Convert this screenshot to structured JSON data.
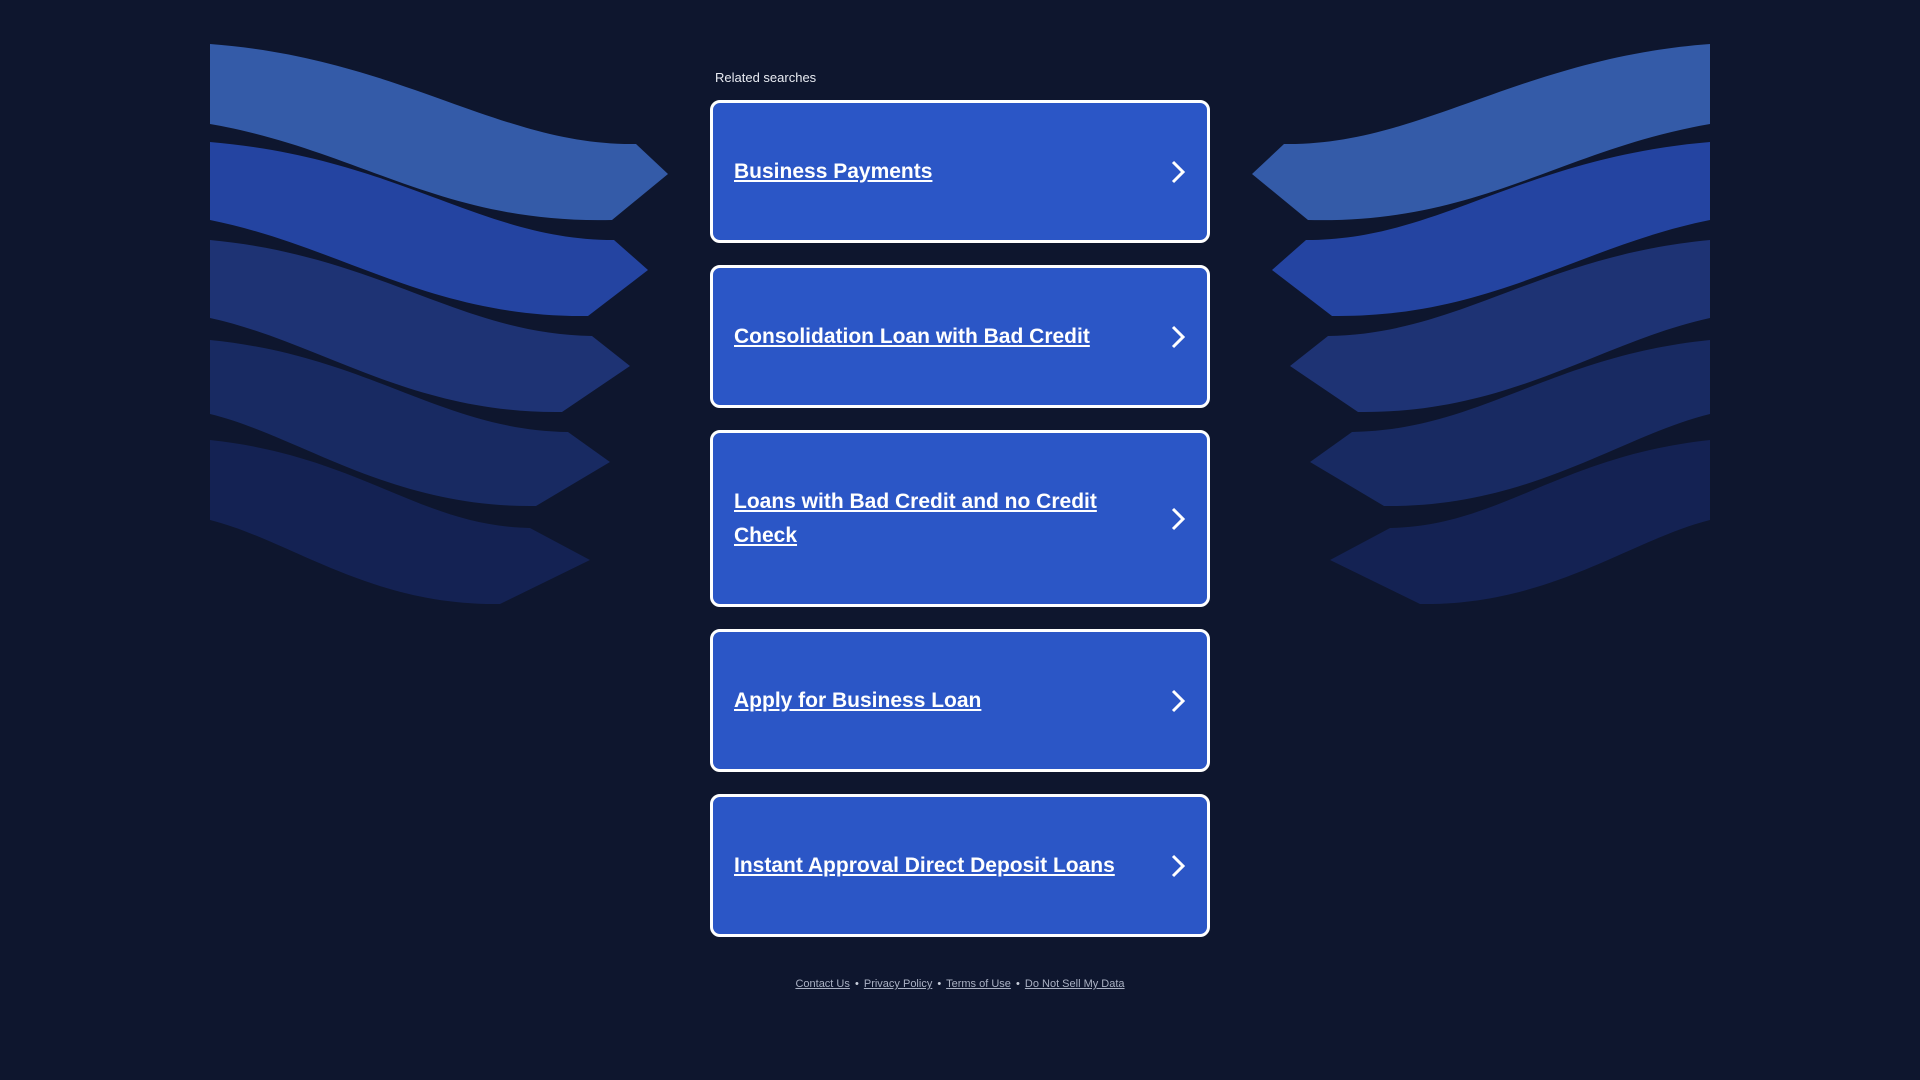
{
  "related": {
    "heading": "Related searches",
    "items": [
      {
        "label": "Business Payments"
      },
      {
        "label": "Consolidation Loan with Bad Credit"
      },
      {
        "label": "Loans with Bad Credit and no Credit Check"
      },
      {
        "label": "Apply for Business Loan"
      },
      {
        "label": "Instant Approval Direct Deposit Loans"
      }
    ]
  },
  "footer": {
    "links": [
      "Contact Us",
      "Privacy Policy",
      "Terms of Use",
      "Do Not Sell My Data"
    ],
    "separator": "•"
  },
  "colors": {
    "background": "#0e162e",
    "card": "#2b56c6",
    "card_border": "#ffffff",
    "wave_1": "#345ba8",
    "wave_2": "#2444a1",
    "wave_3": "#1e3374",
    "wave_4": "#182a62",
    "wave_5": "#142253"
  },
  "icons": {
    "card_arrow": "chevron-right-icon"
  }
}
